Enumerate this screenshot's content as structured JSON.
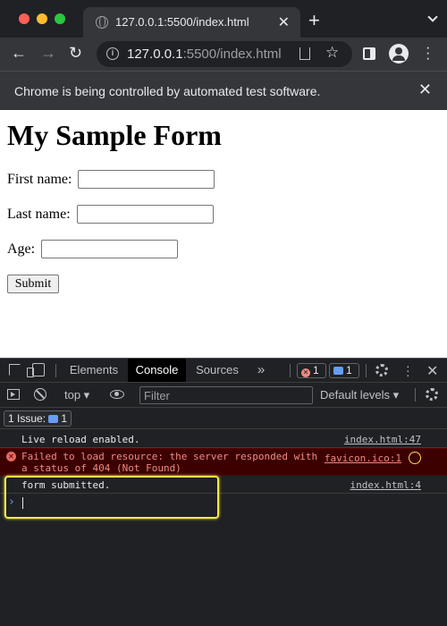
{
  "browser": {
    "tab_title": "127.0.0.1:5500/index.html",
    "tab_close": "✕",
    "new_tab": "+",
    "url_host": "127.0.0.1",
    "url_rest": ":5500/index.html",
    "infobar_text": "Chrome is being controlled by automated test software.",
    "infobar_close": "✕"
  },
  "page": {
    "heading": "My Sample Form",
    "first_name_label": "First name:",
    "last_name_label": "Last name:",
    "age_label": "Age:",
    "first_name_value": "",
    "last_name_value": "",
    "age_value": "",
    "submit_label": "Submit"
  },
  "devtools": {
    "tabs": [
      "Elements",
      "Console",
      "Sources",
      "»"
    ],
    "active_tab": "Console",
    "error_count": "1",
    "issue_count": "1",
    "context": "top ▾",
    "filter_placeholder": "Filter",
    "levels": "Default levels ▾",
    "issues_label": "1 Issue:",
    "issues_count": "1",
    "close": "✕",
    "messages": [
      {
        "text": "Live reload enabled.",
        "source": "index.html:47",
        "level": "info"
      },
      {
        "text": "Failed to load resource: the server responded with a status of 404 (Not Found)",
        "source": "favicon.ico:1",
        "level": "error"
      },
      {
        "text": "form submitted.",
        "source": "index.html:4",
        "level": "info"
      }
    ],
    "prompt": "›"
  },
  "colors": {
    "highlight": "#f3e94a",
    "error_bg": "#3c0000",
    "error_text": "#f28b82",
    "active_tab_bg": "#000000"
  }
}
